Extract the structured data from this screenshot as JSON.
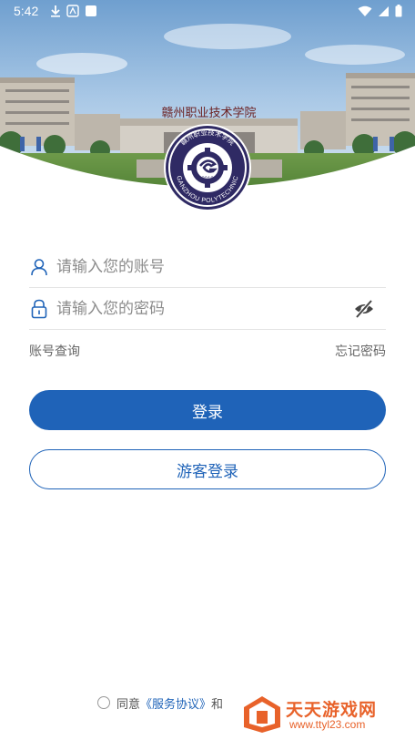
{
  "status_bar": {
    "time": "5:42",
    "left_icons": [
      "download-icon",
      "app-notification-icon",
      "square-icon"
    ],
    "right_icons": [
      "wifi-icon",
      "signal-icon",
      "battery-icon"
    ]
  },
  "banner": {
    "building_sign": "赣州职业技术学院",
    "logo_seal_top": "赣州职业技术学院",
    "logo_seal_bottom": "GANZHOU POLYTECHNIC",
    "logo_year": "2010"
  },
  "form": {
    "account": {
      "placeholder": "请输入您的账号",
      "value": "",
      "icon": "user-icon"
    },
    "password": {
      "placeholder": "请输入您的密码",
      "value": "",
      "icon": "lock-icon",
      "toggle_icon": "eye-off-icon"
    }
  },
  "links": {
    "account_query": "账号查询",
    "forgot_password": "忘记密码"
  },
  "buttons": {
    "login": "登录",
    "guest_login": "游客登录"
  },
  "agreement": {
    "prefix": "同意",
    "service_link": "《服务协议》",
    "suffix": "和"
  },
  "watermark": {
    "title": "天天游戏网",
    "url": "www.ttyl23.com"
  },
  "colors": {
    "primary": "#1f63b8",
    "watermark": "#e8622a",
    "placeholder": "#8c8c8c"
  }
}
